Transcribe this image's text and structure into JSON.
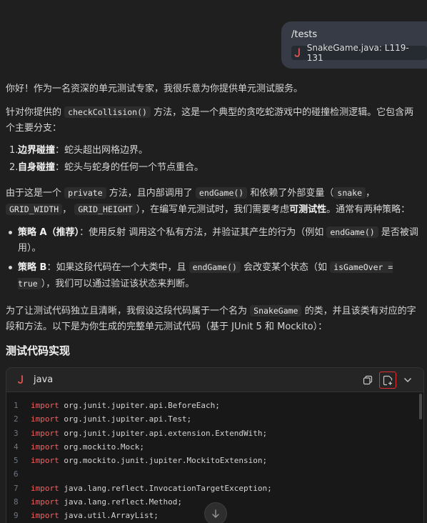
{
  "user_message": {
    "command": "/tests",
    "file_ref": "SnakeGame.java: L119-131"
  },
  "response": {
    "greeting": "你好！作为一名资深的单元测试专家，我很乐意为你提供单元测试服务。",
    "intro_before": "针对你提供的",
    "intro_code": "checkCollision()",
    "intro_after": "方法，这是一个典型的贪吃蛇游戏中的碰撞检测逻辑。它包含两个主要分支：",
    "branches": [
      {
        "num": "1.",
        "title": "边界碰撞",
        "text": "：蛇头超出网格边界。"
      },
      {
        "num": "2.",
        "title": "自身碰撞",
        "text": "：蛇头与蛇身的任何一个节点重合。"
      }
    ],
    "p3": {
      "a": "由于这是一个",
      "code1": "private",
      "b": "方法，且内部调用了",
      "code2": "endGame()",
      "c": "和依赖了外部变量（",
      "code3": "snake",
      "d": "，",
      "code4": "GRID_WIDTH",
      "e": "，",
      "code5": "GRID_HEIGHT",
      "f": "），在编写单元测试时，我们需要考虑",
      "bold": "可测试性",
      "g": "。通常有两种策略："
    },
    "strategies": [
      {
        "title": "策略 A（推荐）",
        "a": "：使用反射 调用这个私有方法，并验证其产生的行为（例如",
        "code": "endGame()",
        "b": "是否被调用）。"
      },
      {
        "title": "策略 B",
        "a": "：如果这段代码在一个大类中，且",
        "code": "endGame()",
        "b": "会改变某个状态（如",
        "code2": "isGameOver = true",
        "c": "），我们可以通过验证该状态来判断。"
      }
    ],
    "p4": {
      "a": "为了让测试代码独立且清晰，我假设这段代码属于一个名为",
      "code": "SnakeGame",
      "b": "的类，并且该类有对应的字段和方法。以下是为你生成的完整单元测试代码（基于 JUnit 5 和 Mockito）："
    },
    "heading": "测试代码实现"
  },
  "code_block": {
    "language": "java",
    "lines": [
      {
        "n": "1",
        "kw": "import",
        "rest": " org.junit.jupiter.api.BeforeEach;"
      },
      {
        "n": "2",
        "kw": "import",
        "rest": " org.junit.jupiter.api.Test;"
      },
      {
        "n": "3",
        "kw": "import",
        "rest": " org.junit.jupiter.api.extension.ExtendWith;"
      },
      {
        "n": "4",
        "kw": "import",
        "rest": " org.mockito.Mock;"
      },
      {
        "n": "5",
        "kw": "import",
        "rest": " org.mockito.junit.jupiter.MockitoExtension;"
      },
      {
        "n": "6",
        "kw": "",
        "rest": ""
      },
      {
        "n": "7",
        "kw": "import",
        "rest": " java.lang.reflect.InvocationTargetException;"
      },
      {
        "n": "8",
        "kw": "import",
        "rest": " java.lang.reflect.Method;"
      },
      {
        "n": "9",
        "kw": "import",
        "rest": " java.util.ArrayList;"
      }
    ]
  },
  "colors": {
    "background": "#1f1f1f",
    "bubble": "#363b45",
    "keyword": "#f36161",
    "java_icon": "#e05555",
    "highlight_border": "#e03030"
  },
  "icons": {
    "file": "java-icon",
    "copy": "copy-icon",
    "insert": "insert-file-icon",
    "expand": "chevron-down-icon",
    "scroll": "arrow-down-icon"
  }
}
